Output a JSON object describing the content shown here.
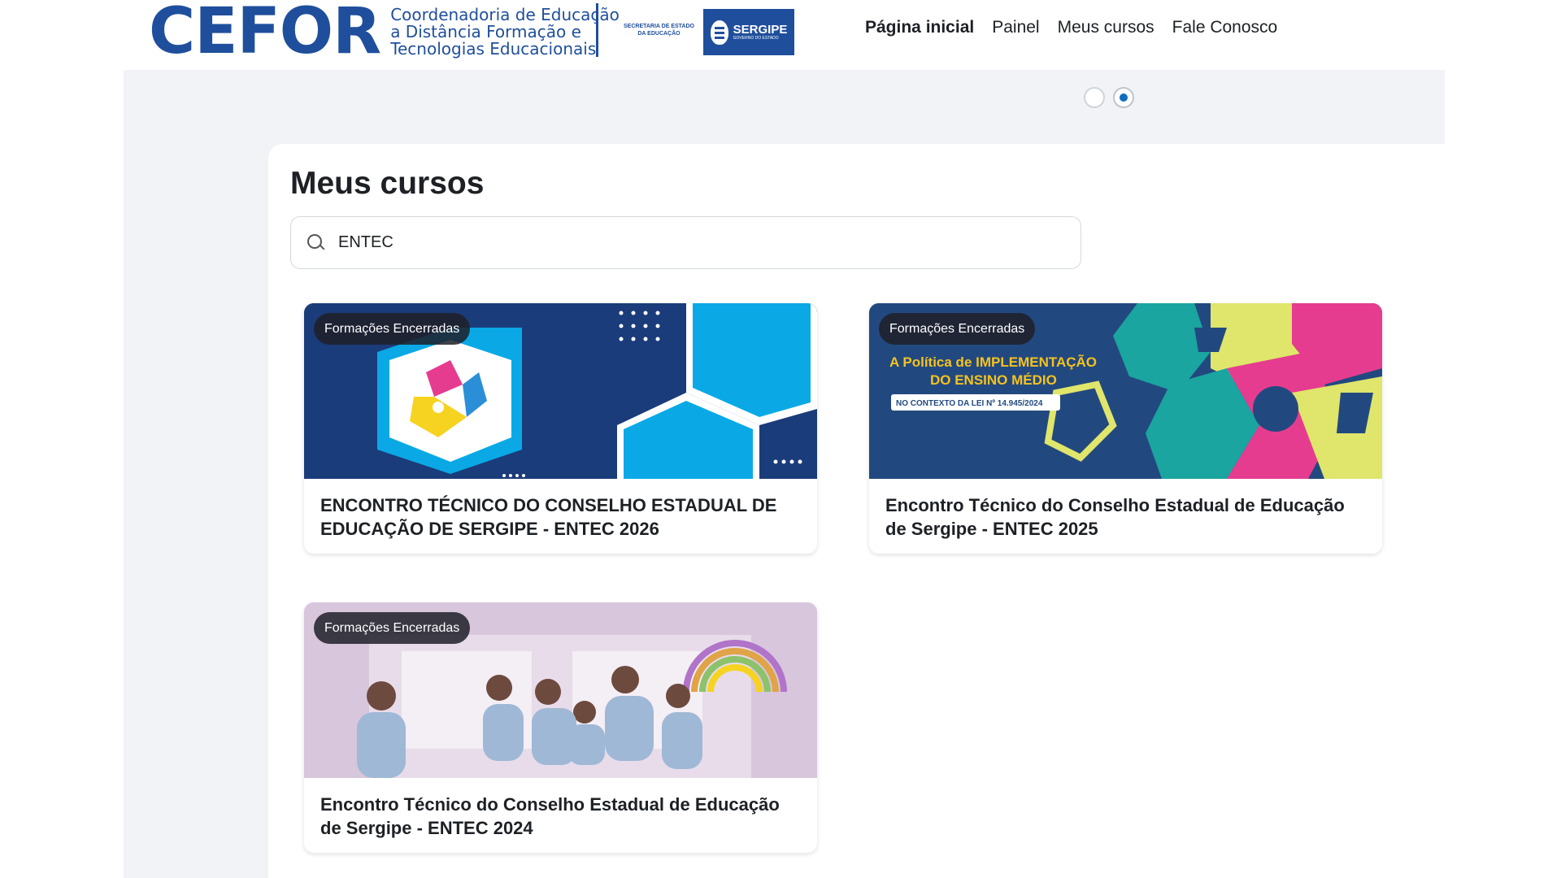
{
  "header": {
    "logo": {
      "name": "CEFOR",
      "subtitle_line1": "Coordenadoria de Educação",
      "subtitle_line2": "a Distância Formação e",
      "subtitle_line3": "Tecnologias Educacionais",
      "secretaria_line1": "SECRETARIA DE ESTADO",
      "secretaria_line2": "DA EDUCAÇÃO",
      "state_name": "SERGIPE",
      "state_sub": "GOVERNO DO ESTADO"
    },
    "nav": [
      {
        "label": "Página inicial",
        "active": true
      },
      {
        "label": "Painel",
        "active": false
      },
      {
        "label": "Meus cursos",
        "active": false
      },
      {
        "label": "Fale Conosco",
        "active": false
      }
    ]
  },
  "carousel": {
    "dots": 2,
    "active_index": 1
  },
  "main": {
    "title": "Meus cursos",
    "search": {
      "value": "ENTEC",
      "placeholder": ""
    },
    "courses": [
      {
        "badge": "Formações Encerradas",
        "title": "ENCONTRO TÉCNICO DO CONSELHO ESTADUAL DE EDUCAÇÃO DE SERGIPE - ENTEC 2026"
      },
      {
        "badge": "Formações Encerradas",
        "title": "Encontro Técnico do Conselho Estadual de Educação de Sergipe - ENTEC 2025",
        "image_text_line1": "A Política de IMPLEMENTAÇÃO",
        "image_text_line2": "DO ENSINO MÉDIO",
        "image_text_line3": "NO CONTEXTO DA LEI Nº 14.945/2024"
      },
      {
        "badge": "Formações Encerradas",
        "title": "Encontro Técnico do Conselho Estadual de Educação de Sergipe - ENTEC 2024"
      }
    ]
  },
  "colors": {
    "brand_blue": "#1f4f9c",
    "page_gray": "#f1f3f6",
    "accent": "#0f6cbf",
    "cyan": "#0aa9e6"
  }
}
